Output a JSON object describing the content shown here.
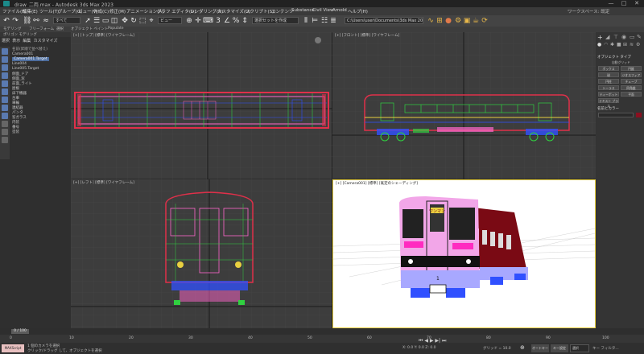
{
  "window": {
    "title": "draw_二両.max - Autodesk 3ds Max 2023",
    "minimize": "—",
    "maximize": "□",
    "close": "✕"
  },
  "menu": {
    "items": [
      "ファイル(F)",
      "編集(E)",
      "ツール(T)",
      "グループ(G)",
      "ビュー(V)",
      "作成(C)",
      "修正(M)",
      "アニメーション(A)",
      "グラフ エディタ(D)",
      "レンダリング(R)",
      "カスタマイズ(U)",
      "スクリプト(S)",
      "コンテンツ",
      "Substance",
      "Civil View",
      "Arnold",
      "ヘルプ(H)"
    ],
    "workspace": "ワークスペース: 既定"
  },
  "toolbar": {
    "filter": "すべて",
    "view": "ビュー",
    "selection_set": "選択セットを作成",
    "path": "C:\\Users\\user\\Documents\\3ds Max 2023"
  },
  "ribbon": {
    "tabs": [
      "モデリング",
      "フリーフォーム",
      "選択",
      "オブジェクト ペイント",
      "Populate"
    ],
    "sub": "ポリゴン モデリング"
  },
  "scene_explorer": {
    "tabs": [
      "選択",
      "表示",
      "編集",
      "カスタマイズ"
    ],
    "root": "名前(昇順で並べ替え)",
    "items": [
      "Camera001",
      "Camera001.Target",
      "Line004",
      "Line005.Target",
      "側面_ドア",
      "側面_窓",
      "前面_ライト",
      "屋根",
      "床下機器",
      "台車",
      "車輪",
      "連結器",
      "パンタ",
      "窓ガラス",
      "内装",
      "番号",
      "塗装"
    ],
    "selected_index": 1
  },
  "viewports": {
    "top": "[+] [トップ] [標準] [ワイヤフレーム]",
    "front": "[+] [フロント] [標準] [ワイヤフレーム]",
    "left": "[+] [レフト] [標準] [ワイヤフレーム]",
    "camera": "[+] [Camera001] [標準] [既定のシェーディング]",
    "destination_sign": "ワンマン",
    "car_number": "1"
  },
  "command_panel": {
    "section1": "オブジェクト タイプ",
    "autogrid": "自動グリッド",
    "buttons": [
      "ボックス",
      "円錐",
      "球",
      "ジオスフィア",
      "円柱",
      "チューブ",
      "トーラス",
      "四角錐",
      "ティーポット",
      "平面",
      "テキスト プラス"
    ],
    "section2": "名前とカラー"
  },
  "timeline": {
    "frame": "0 / 100",
    "ticks": [
      "0",
      "10",
      "20",
      "30",
      "40",
      "50",
      "60",
      "70",
      "80",
      "90",
      "100"
    ]
  },
  "status": {
    "selection": "1 個のカメラを選択",
    "hint": "クリック/ドラッグ して、オブジェクトを選択",
    "coords": "X: 0.0   Y: 0.0   Z: 0.0",
    "grid": "グリッド = 10.0",
    "maxscript": "MAXScript",
    "autokey": "オートキー",
    "setkey": "キー設定",
    "selected": "選択",
    "key_filter": "キー フィルタ..."
  },
  "colors": {
    "wire_red": "#e0304a",
    "wire_green": "#30d040",
    "wire_blue": "#3050ff",
    "wire_pink": "#ff66cc",
    "train_pink": "#f2a6e8",
    "train_dark": "#7a0a14",
    "accent": "#4d6d9e"
  }
}
